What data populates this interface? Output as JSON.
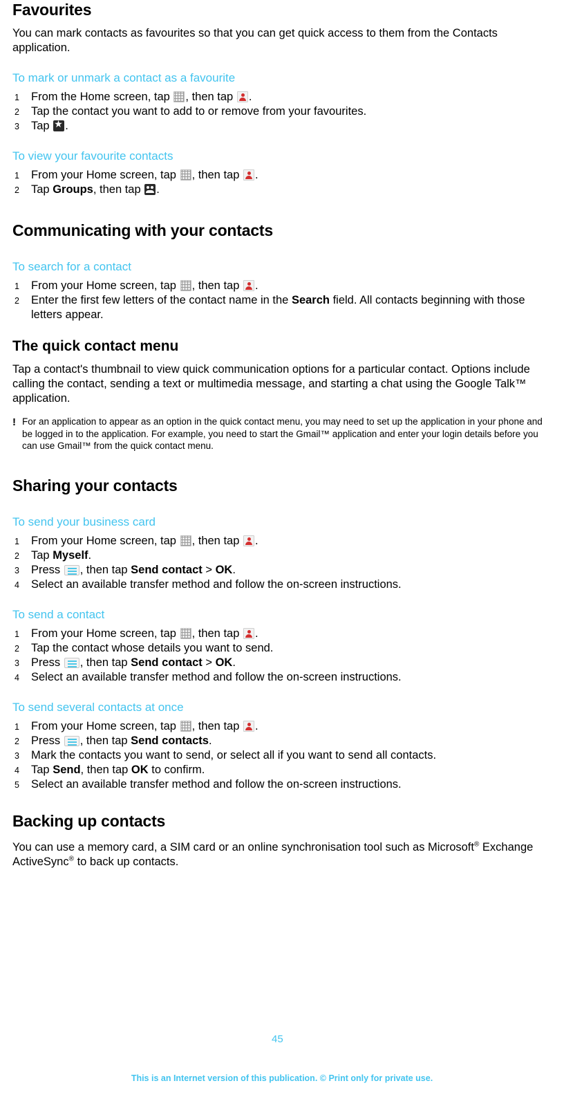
{
  "sections": {
    "favourites": {
      "title": "Favourites",
      "intro": "You can mark contacts as favourites so that you can get quick access to them from the Contacts application.",
      "proc1": {
        "title": "To mark or unmark a contact as a favourite",
        "s1a": "From the Home screen, tap ",
        "s1b": ", then tap ",
        "s1c": ".",
        "s2": "Tap the contact you want to add to or remove from your favourites.",
        "s3a": "Tap ",
        "s3b": "."
      },
      "proc2": {
        "title": "To view your favourite contacts",
        "s1a": "From your Home screen, tap ",
        "s1b": ", then tap ",
        "s1c": ".",
        "s2a": "Tap ",
        "s2b": "Groups",
        "s2c": ", then tap ",
        "s2d": "."
      }
    },
    "communicating": {
      "title": "Communicating with your contacts",
      "search": {
        "title": "To search for a contact",
        "s1a": "From your Home screen, tap ",
        "s1b": ", then tap ",
        "s1c": ".",
        "s2a": "Enter the first few letters of the contact name in the ",
        "s2b": "Search",
        "s2c": " field. All contacts beginning with those letters appear."
      },
      "quick_menu": {
        "title": "The quick contact menu",
        "body": "Tap a contact's thumbnail to view quick communication options for a particular contact. Options include calling the contact, sending a text or multimedia message, and starting a chat using the Google Talk™ application.",
        "note": "For an application to appear as an option in the quick contact menu, you may need to set up the application in your phone and be logged in to the application. For example, you need to start the Gmail™ application and enter your login details before you can use Gmail™ from the quick contact menu."
      }
    },
    "sharing": {
      "title": "Sharing your contacts",
      "business_card": {
        "title": "To send your business card",
        "s1a": "From your Home screen, tap ",
        "s1b": ", then tap ",
        "s1c": ".",
        "s2a": "Tap ",
        "s2b": "Myself",
        "s2c": ".",
        "s3a": "Press ",
        "s3b": ", then tap ",
        "s3c": "Send contact",
        "s3d": " > ",
        "s3e": "OK",
        "s3f": ".",
        "s4": "Select an available transfer method and follow the on-screen instructions."
      },
      "send_contact": {
        "title": "To send a contact",
        "s1a": "From your Home screen, tap ",
        "s1b": ", then tap ",
        "s1c": ".",
        "s2": "Tap the contact whose details you want to send.",
        "s3a": "Press ",
        "s3b": ", then tap ",
        "s3c": "Send contact",
        "s3d": " > ",
        "s3e": "OK",
        "s3f": ".",
        "s4": "Select an available transfer method and follow the on-screen instructions."
      },
      "send_several": {
        "title": "To send several contacts at once",
        "s1a": "From your Home screen, tap ",
        "s1b": ", then tap ",
        "s1c": ".",
        "s2a": "Press ",
        "s2b": ", then tap ",
        "s2c": "Send contacts",
        "s2d": ".",
        "s3": "Mark the contacts you want to send, or select all if you want to send all contacts.",
        "s4a": "Tap ",
        "s4b": "Send",
        "s4c": ", then tap ",
        "s4d": "OK",
        "s4e": " to confirm.",
        "s5": "Select an available transfer method and follow the on-screen instructions."
      }
    },
    "backing_up": {
      "title": "Backing up contacts",
      "body_a": "You can use a memory card, a SIM card or an online synchronisation tool such as Microsoft",
      "body_sup1": "®",
      "body_b": " Exchange ActiveSync",
      "body_sup2": "®",
      "body_c": " to back up contacts."
    }
  },
  "page_number": "45",
  "footer": "This is an Internet version of this publication. © Print only for private use.",
  "colors": {
    "accent": "#43c4ef",
    "text": "#000000"
  },
  "icons": {
    "apps": "apps-grid-icon",
    "contacts": "contacts-icon",
    "star": "star-icon",
    "group": "group-icon",
    "menu": "menu-key-icon"
  }
}
